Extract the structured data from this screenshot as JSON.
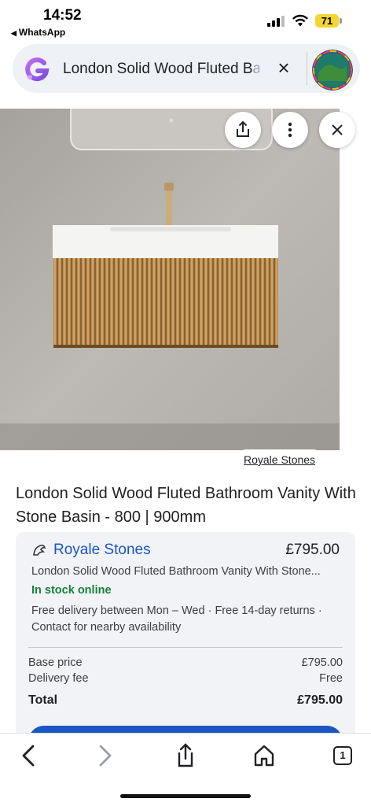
{
  "status_bar": {
    "time": "14:52",
    "back_app": "WhatsApp",
    "battery": "71"
  },
  "search": {
    "query_visible": "London Solid Wood Fluted B",
    "query_faded": "a..."
  },
  "image": {
    "source_label": "Royale Stones"
  },
  "product": {
    "title": "London Solid Wood Fluted Bathroom Vanity With Stone Basin - 800 | 900mm"
  },
  "offer": {
    "merchant": "Royale Stones",
    "price": "£795.00",
    "description": "London Solid Wood Fluted Bathroom Vanity With Stone...",
    "stock": "In stock online",
    "delivery": "Free delivery between Mon – Wed · Free 14-day returns · Contact for nearby availability",
    "base_price_label": "Base price",
    "base_price_value": "£795.00",
    "delivery_fee_label": "Delivery fee",
    "delivery_fee_value": "Free",
    "total_label": "Total",
    "total_value": "£795.00"
  },
  "toolbar": {
    "tab_count": "1"
  },
  "colors": {
    "link_blue": "#1a56c4",
    "stock_green": "#188038",
    "battery_yellow": "#f5d530",
    "card_bg": "#f1f3f6"
  },
  "icons": [
    "share-icon",
    "more-icon",
    "close-icon",
    "back-icon",
    "forward-icon",
    "home-icon",
    "tabs-icon",
    "google-lens-icon",
    "wifi-icon",
    "signal-icon"
  ]
}
